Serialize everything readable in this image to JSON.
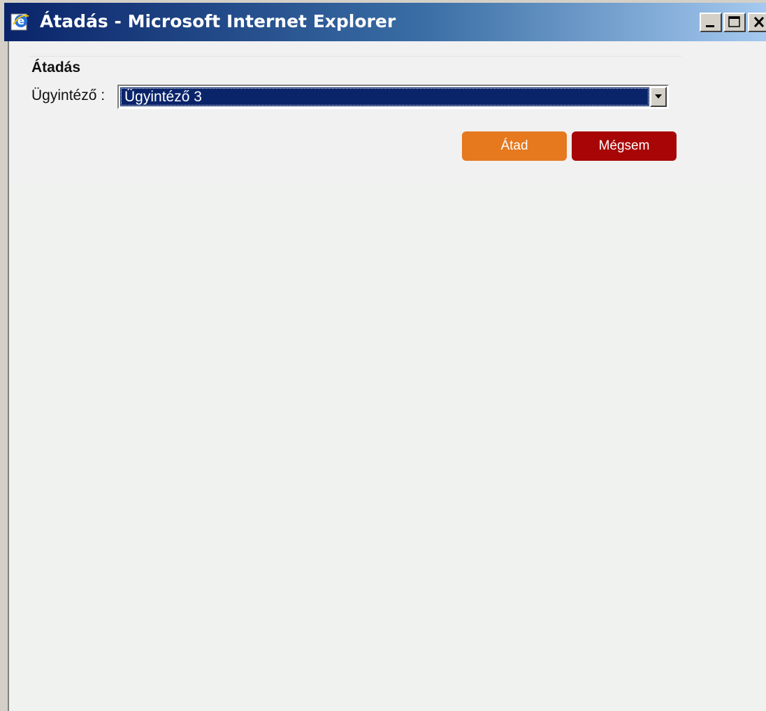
{
  "window": {
    "title": "Átadás - Microsoft Internet Explorer",
    "controls": [
      "minimize",
      "maximize",
      "close"
    ]
  },
  "dialog": {
    "heading": "Átadás",
    "field_label": "Ügyintéző :",
    "select": {
      "selected_value": "Ügyintéző 3"
    },
    "buttons": {
      "submit_label": "Átad",
      "cancel_label": "Mégsem"
    }
  },
  "colors": {
    "titlebar_start": "#0a246a",
    "submit_button": "#e6781e",
    "cancel_button": "#a80606",
    "selection": "#0a246a"
  },
  "icons": {
    "app": "internet-explorer-icon",
    "minimize": "minimize-icon",
    "maximize": "maximize-icon",
    "close": "close-icon",
    "dropdown": "chevron-down-icon"
  }
}
